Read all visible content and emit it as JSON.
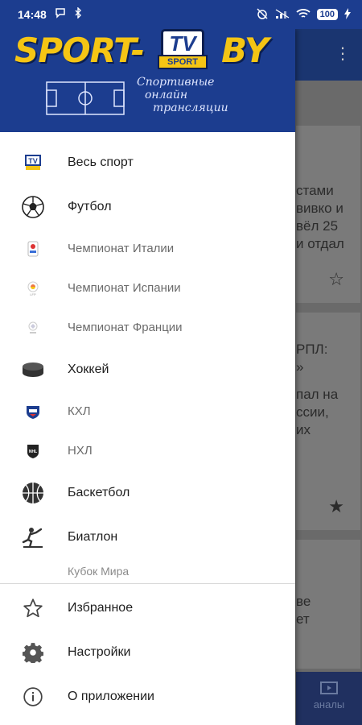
{
  "status_bar": {
    "time": "14:48",
    "battery": "100"
  },
  "header": {
    "logo_left": "SPORT-",
    "logo_right": "BY",
    "logo_tv": "TV",
    "logo_sport": "SPORT",
    "tagline": [
      "Спортивные",
      "онлайн",
      "трансляции"
    ]
  },
  "menu": {
    "items": [
      {
        "label": "Весь спорт",
        "icon": "tv-sport-icon",
        "type": "main"
      },
      {
        "label": "Футбол",
        "icon": "soccer-ball-icon",
        "type": "main"
      },
      {
        "label": "Чемпионат Италии",
        "icon": "serie-a-icon",
        "type": "sub"
      },
      {
        "label": "Чемпионат Испании",
        "icon": "laliga-icon",
        "type": "sub"
      },
      {
        "label": "Чемпионат Франции",
        "icon": "ligue1-icon",
        "type": "sub"
      },
      {
        "label": "Хоккей",
        "icon": "hockey-puck-icon",
        "type": "main"
      },
      {
        "label": "КХЛ",
        "icon": "khl-icon",
        "type": "sub"
      },
      {
        "label": "НХЛ",
        "icon": "nhl-icon",
        "type": "sub"
      },
      {
        "label": "Баскетбол",
        "icon": "basketball-icon",
        "type": "main"
      },
      {
        "label": "Биатлон",
        "icon": "biathlon-icon",
        "type": "main"
      }
    ],
    "caption": "Кубок Мира",
    "bottom_items": [
      {
        "label": "Избранное",
        "icon": "star-outline-icon"
      },
      {
        "label": "Настройки",
        "icon": "gear-icon"
      },
      {
        "label": "О приложении",
        "icon": "info-icon"
      }
    ]
  },
  "background": {
    "card1_lines": [
      "стами",
      "вивко и",
      "вёл 25",
      "и отдал"
    ],
    "card2_lines": [
      "РПЛ:",
      "»",
      "пал на",
      "ссии,",
      "их"
    ],
    "card3_lines": [
      "ве",
      "ет"
    ],
    "bottom_nav_label": "аналы"
  },
  "colors": {
    "brand_blue": "#1c3d8f",
    "logo_yellow": "#f5c514"
  }
}
